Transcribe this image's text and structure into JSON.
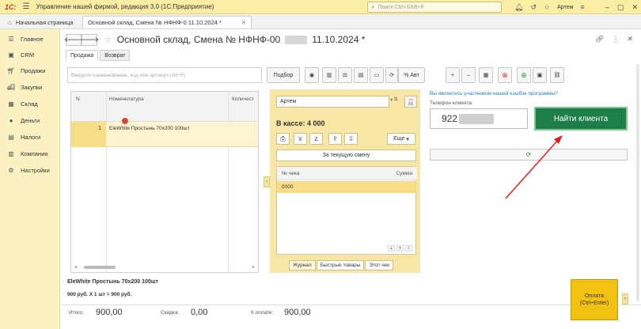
{
  "titlebar": {
    "logo": "1С:",
    "app_title": "Управление нашей фирмой, редакция 3.0  (1С:Предприятие)",
    "search_placeholder": "Поиск Ctrl+Shift+F",
    "user": "Артем"
  },
  "tabs": [
    {
      "label": "Начальная страница"
    },
    {
      "label": "Основной склад, Смена № НФНФ-0        11.10.2024 *"
    }
  ],
  "sidebar": {
    "items": [
      {
        "label": "Главное",
        "icon": "menu-icon"
      },
      {
        "label": "CRM",
        "icon": "crm-icon"
      },
      {
        "label": "Продажи",
        "icon": "sales-icon"
      },
      {
        "label": "Закупки",
        "icon": "purchase-icon"
      },
      {
        "label": "Склад",
        "icon": "warehouse-icon"
      },
      {
        "label": "Деньги",
        "icon": "money-icon"
      },
      {
        "label": "Налоги",
        "icon": "tax-icon"
      },
      {
        "label": "Компания",
        "icon": "company-icon"
      },
      {
        "label": "Настройки",
        "icon": "settings-icon"
      }
    ]
  },
  "doc": {
    "title_prefix": "Основной склад, Смена № НФНФ-00",
    "title_suffix": "11.10.2024 *",
    "subtabs": [
      "Продажа",
      "Возврат"
    ]
  },
  "toolbar": {
    "search_placeholder": "Введите наименование, код или артикул (Alt+F)",
    "select_label": "Подбор",
    "discount_label": "% Авт"
  },
  "grid": {
    "headers": [
      "N",
      "Номенклатура",
      "Количест"
    ],
    "rows": [
      {
        "n": "1",
        "name": "EleWhite Простынь 70х200 100шт"
      }
    ]
  },
  "pos": {
    "cashier": "Артем",
    "in_cash": "В кассе: 4 000",
    "more_label": "Еще",
    "period": "За текущую смену",
    "receipt_headers": [
      "№ чека",
      "Сумма"
    ],
    "receipt_rows": [
      {
        "num": "0000"
      }
    ],
    "tabs": [
      "Журнал",
      "Быстрые товары",
      "Этот чек"
    ]
  },
  "customer": {
    "loyalty_link": "Вы являетесь участником нашей кэшбэк программы?",
    "phone_label": "Телефон клиента:",
    "phone_value": "922",
    "find_label": "Найти клиента"
  },
  "summary": {
    "selected_name": "EleWhite Простынь 70х200 100шт",
    "selected_price": "900 руб. Х 1 шт = 900 руб.",
    "total_label": "Итого:",
    "total_value": "900,00",
    "discount_label": "Скидка:",
    "discount_value": "0,00",
    "due_label": "К оплате:",
    "due_value": "900,00",
    "pay_label": "Оплата",
    "pay_hotkey": "(Ctrl+Enter)"
  }
}
